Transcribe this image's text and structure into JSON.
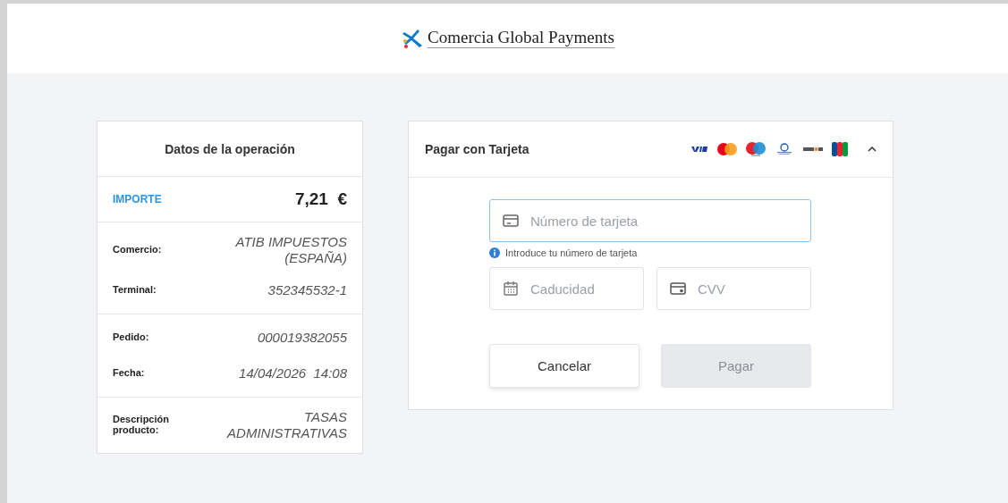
{
  "header": {
    "brand": "Comercia Global Payments"
  },
  "summary": {
    "title": "Datos de la operación",
    "amount_label": "IMPORTE",
    "amount": "7,21  €",
    "sections": [
      [
        {
          "label": "Comercio:",
          "value": "ATIB IMPUESTOS (ESPAÑA)"
        },
        {
          "label": "Terminal:",
          "value": "352345532-1"
        }
      ],
      [
        {
          "label": "Pedido:",
          "value": "000019382055"
        },
        {
          "label": "Fecha:",
          "value": "14/04/2026  14:08"
        }
      ],
      [
        {
          "label": "Descripción producto:",
          "value": "TASAS ADMINISTRATIVAS"
        }
      ]
    ]
  },
  "payment": {
    "title": "Pagar con Tarjeta",
    "expanded": true,
    "card_number": {
      "placeholder": "Número de tarjeta",
      "focused": true,
      "hint": "Introduce tu número de tarjeta"
    },
    "expiry": {
      "placeholder": "Caducidad",
      "focused": false
    },
    "cvv": {
      "placeholder": "CVV",
      "focused": false
    },
    "buttons": [
      {
        "label": "Cancelar",
        "kind": "secondary",
        "disabled": false
      },
      {
        "label": "Pagar",
        "kind": "primary",
        "disabled": true
      }
    ]
  }
}
